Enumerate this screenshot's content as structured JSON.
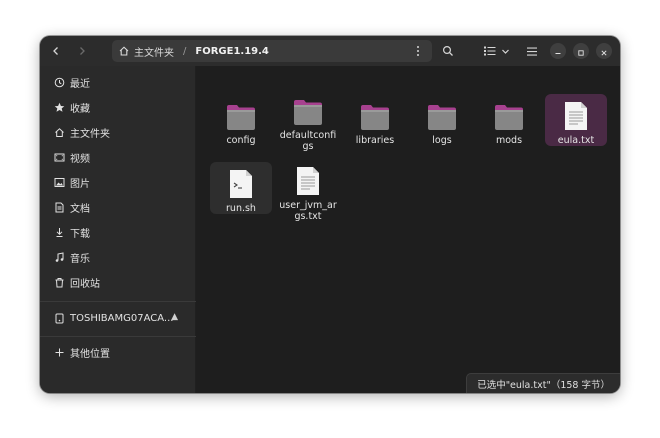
{
  "headerbar": {
    "back_icon": "chevron-left-icon",
    "forward_icon": "chevron-right-icon",
    "path_home_label": "主文件夹",
    "path_separator": "/",
    "path_current": "FORGE1.19.4",
    "search_icon": "search-icon",
    "view_icon": "list-view-icon",
    "menu_icon": "hamburger-icon"
  },
  "sidebar": {
    "items": [
      {
        "label": "最近",
        "icon": "clock-icon"
      },
      {
        "label": "收藏",
        "icon": "star-icon"
      },
      {
        "label": "主文件夹",
        "icon": "home-icon"
      },
      {
        "label": "视频",
        "icon": "video-icon"
      },
      {
        "label": "图片",
        "icon": "image-icon"
      },
      {
        "label": "文档",
        "icon": "document-icon"
      },
      {
        "label": "下载",
        "icon": "download-icon"
      },
      {
        "label": "音乐",
        "icon": "music-icon"
      },
      {
        "label": "回收站",
        "icon": "trash-icon"
      }
    ],
    "drive": {
      "label": "TOSHIBAMG07ACA...",
      "icon": "drive-icon",
      "eject_icon": "eject-icon"
    },
    "other": {
      "label": "其他位置",
      "icon": "plus-icon"
    }
  },
  "files": [
    {
      "name": "config",
      "type": "folder"
    },
    {
      "name": "defaultconfigs",
      "type": "folder"
    },
    {
      "name": "libraries",
      "type": "folder"
    },
    {
      "name": "logs",
      "type": "folder"
    },
    {
      "name": "mods",
      "type": "folder"
    },
    {
      "name": "eula.txt",
      "type": "text",
      "selected": true
    },
    {
      "name": "run.sh",
      "type": "script"
    },
    {
      "name": "user_jvm_args.txt",
      "type": "text"
    }
  ],
  "status": {
    "text": "已选中\"eula.txt\"（158 字节）"
  },
  "colors": {
    "accent": "#a7418f",
    "window_bg": "#1e1e1e",
    "sidebar_bg": "#2a2a2a",
    "selection": "#4a2a45"
  }
}
